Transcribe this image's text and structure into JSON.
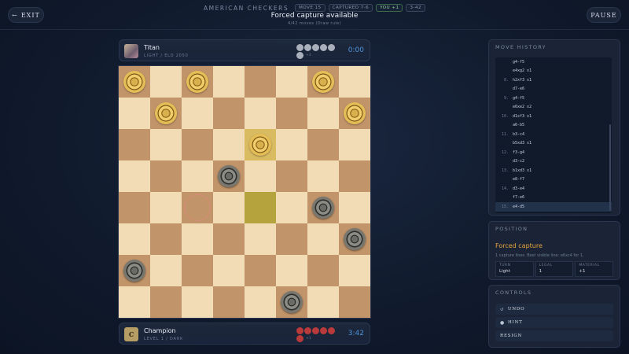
{
  "header": {
    "exit_label": "EXIT",
    "exit_icon": "arrow-left-icon",
    "app_title": "AMERICAN CHECKERS",
    "tags": {
      "move": "MOVE 15",
      "captured": "CAPTURED 7-6",
      "you": "YOU +1",
      "score": "3-42"
    },
    "status_title": "Forced capture available",
    "status_sub": "4/42 moves (Draw rule)",
    "pause_label": "PAUSE"
  },
  "player_top": {
    "name": "Titan",
    "sub": "LIGHT / ELO 2050",
    "remaining_extra": "+3",
    "clock": "0:00"
  },
  "player_bottom": {
    "avatar_letter": "C",
    "name": "Champion",
    "sub": "LEVEL 1 / DARK",
    "remaining_extra": "+1",
    "clock": "3:42"
  },
  "board": {
    "rows": 8,
    "cols": 8,
    "pieces": [
      {
        "row": 0,
        "col": 0,
        "color": "light"
      },
      {
        "row": 0,
        "col": 2,
        "color": "light"
      },
      {
        "row": 0,
        "col": 6,
        "color": "light"
      },
      {
        "row": 1,
        "col": 1,
        "color": "light"
      },
      {
        "row": 1,
        "col": 7,
        "color": "light"
      },
      {
        "row": 2,
        "col": 4,
        "color": "light"
      },
      {
        "row": 3,
        "col": 3,
        "color": "dark"
      },
      {
        "row": 4,
        "col": 6,
        "color": "dark"
      },
      {
        "row": 5,
        "col": 7,
        "color": "dark"
      },
      {
        "row": 6,
        "col": 0,
        "color": "dark"
      },
      {
        "row": 7,
        "col": 5,
        "color": "dark"
      }
    ],
    "last_move_to": {
      "row": 2,
      "col": 4
    },
    "last_move_from": {
      "row": 4,
      "col": 4
    },
    "capture_target": {
      "row": 4,
      "col": 2
    }
  },
  "history": {
    "title": "MOVE HISTORY",
    "rows": [
      {
        "num": "",
        "move": "g4-f5"
      },
      {
        "num": "",
        "move": "e4xg2 x1"
      },
      {
        "num": "8.",
        "move": "h2xf3 x1"
      },
      {
        "num": "",
        "move": "d7-e6"
      },
      {
        "num": "9.",
        "move": "g4-f5"
      },
      {
        "num": "",
        "move": "e6xe2 x2"
      },
      {
        "num": "10.",
        "move": "d1xf3 x1"
      },
      {
        "num": "",
        "move": "a6-b5"
      },
      {
        "num": "11.",
        "move": "b3-c4"
      },
      {
        "num": "",
        "move": "b5xd3 x1"
      },
      {
        "num": "12.",
        "move": "f3-g4"
      },
      {
        "num": "",
        "move": "d3-c2"
      },
      {
        "num": "13.",
        "move": "b1xd3 x1"
      },
      {
        "num": "",
        "move": "e8-f7"
      },
      {
        "num": "14.",
        "move": "d3-e4"
      },
      {
        "num": "",
        "move": "f7-e6"
      },
      {
        "num": "15.",
        "move": "e4-d5"
      }
    ],
    "active_index": 16
  },
  "position": {
    "title": "POSITION",
    "headline": "Forced capture",
    "desc": "1 capture lines. Best visible line: e6xc4 for 1.",
    "stats": [
      {
        "key": "TURN",
        "value": "Light"
      },
      {
        "key": "LEGAL",
        "value": "1"
      },
      {
        "key": "MATERIAL",
        "value": "+1"
      }
    ]
  },
  "controls": {
    "title": "CONTROLS",
    "undo_label": "UNDO",
    "undo_icon": "undo-icon",
    "hint_label": "HINT",
    "hint_icon": "lightbulb-icon",
    "resign_label": "RESIGN"
  },
  "colors": {
    "light_square": "#f2dcb5",
    "dark_square": "#c29469",
    "accent_blue": "#4f93d9",
    "warning_orange": "#e8a43c",
    "captured_red": "#b83a3a"
  }
}
